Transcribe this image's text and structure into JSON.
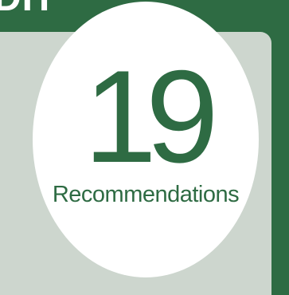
{
  "header": {
    "text": "DH"
  },
  "stat": {
    "value": "19",
    "label": "Recommendations"
  },
  "colors": {
    "brand_green": "#2e6b43",
    "panel": "#cdd6ce",
    "circle": "#ffffff",
    "header_text": "#ffffff"
  }
}
